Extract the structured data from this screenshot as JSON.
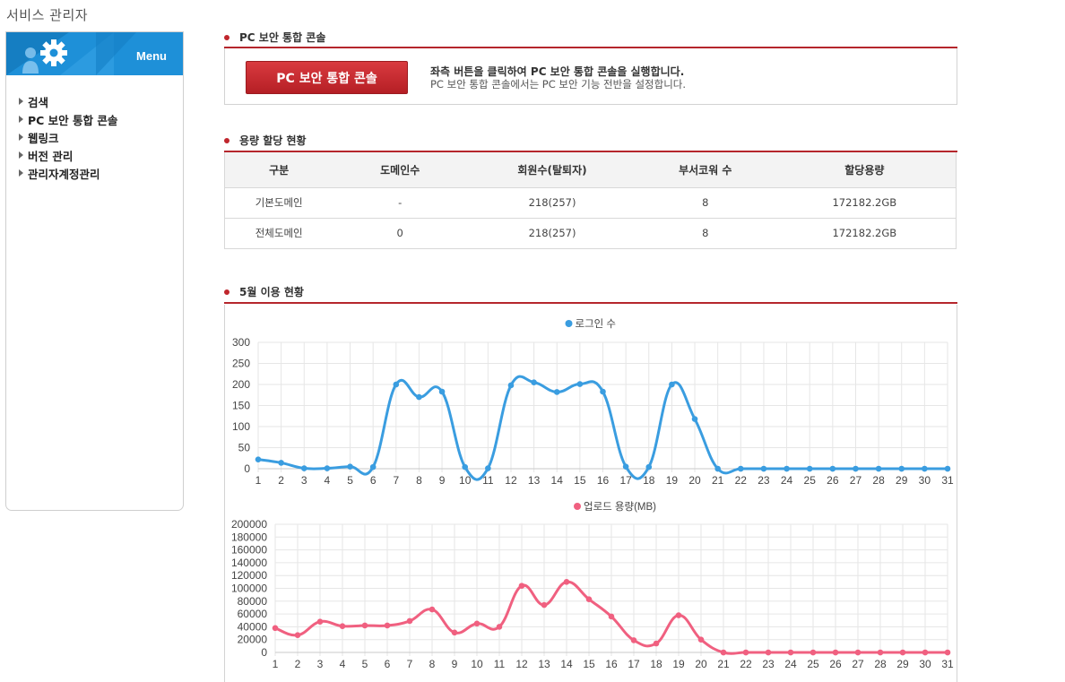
{
  "app": {
    "title": "서비스 관리자"
  },
  "sidebar": {
    "menu_label": "Menu",
    "items": [
      {
        "label": "검색"
      },
      {
        "label": "PC 보안 통합 콘솔"
      },
      {
        "label": "웹링크"
      },
      {
        "label": "버전 관리"
      },
      {
        "label": "관리자계정관리"
      }
    ]
  },
  "console_section": {
    "title": "PC 보안 통합 콘솔",
    "button_label": "PC 보안 통합 콘솔",
    "desc_line1": "좌측 버튼을 클릭하여 PC 보안 통합 콘솔을 실행합니다.",
    "desc_line2": "PC 보안 통합 콘솔에서는 PC 보안 기능 전반을 설정합니다."
  },
  "quota_section": {
    "title": "용량 할당 현황",
    "columns": [
      "구분",
      "도메인수",
      "회원수(탈퇴자)",
      "부서코워 수",
      "할당용량"
    ],
    "rows": [
      [
        "기본도메인",
        "-",
        "218(257)",
        "8",
        "172182.2GB"
      ],
      [
        "전체도메인",
        "0",
        "218(257)",
        "8",
        "172182.2GB"
      ]
    ]
  },
  "usage_section": {
    "title": "5월 이용 현황"
  },
  "colors": {
    "accent_red": "#b5262c",
    "login_series": "#3a9de0",
    "upload_series": "#f06080"
  },
  "chart_data": [
    {
      "type": "line",
      "x": [
        1,
        2,
        3,
        4,
        5,
        6,
        7,
        8,
        9,
        10,
        11,
        12,
        13,
        14,
        15,
        16,
        17,
        18,
        19,
        20,
        21,
        22,
        23,
        24,
        25,
        26,
        27,
        28,
        29,
        30,
        31
      ],
      "series": [
        {
          "name": "로그인 수",
          "values": [
            22,
            14,
            1,
            1,
            5,
            4,
            200,
            170,
            183,
            4,
            1,
            198,
            205,
            182,
            201,
            183,
            5,
            4,
            200,
            118,
            0,
            0,
            0,
            0,
            0,
            0,
            0,
            0,
            0,
            0,
            0
          ]
        }
      ],
      "ylim": [
        0,
        300
      ],
      "yticks": [
        0,
        50,
        100,
        150,
        200,
        250,
        300
      ],
      "legend": "top-center",
      "grid": true
    },
    {
      "type": "line",
      "x": [
        1,
        2,
        3,
        4,
        5,
        6,
        7,
        8,
        9,
        10,
        11,
        12,
        13,
        14,
        15,
        16,
        17,
        18,
        19,
        20,
        21,
        22,
        23,
        24,
        25,
        26,
        27,
        28,
        29,
        30,
        31
      ],
      "series": [
        {
          "name": "업로드 용량(MB)",
          "values": [
            38000,
            27000,
            48000,
            41000,
            42000,
            42000,
            49000,
            67000,
            31000,
            45000,
            40000,
            104000,
            74000,
            110000,
            83000,
            56000,
            19000,
            14000,
            58000,
            20000,
            0,
            0,
            0,
            0,
            0,
            0,
            0,
            0,
            0,
            0,
            0
          ]
        }
      ],
      "ylim": [
        0,
        200000
      ],
      "yticks": [
        0,
        20000,
        40000,
        60000,
        80000,
        100000,
        120000,
        140000,
        160000,
        180000,
        200000
      ],
      "legend": "top-center",
      "grid": true
    }
  ]
}
